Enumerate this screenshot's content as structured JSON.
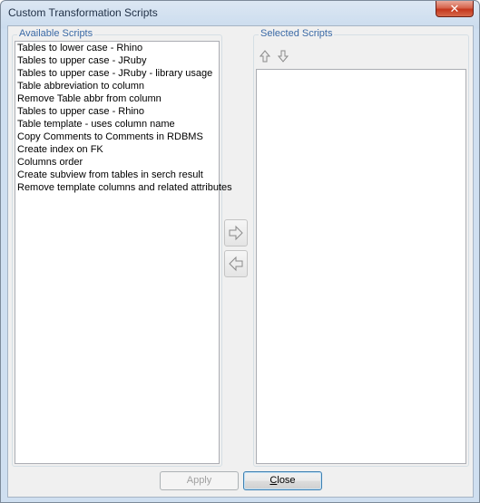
{
  "window": {
    "title": "Custom Transformation Scripts",
    "close_glyph": "✕"
  },
  "available": {
    "label": "Available Scripts",
    "items": [
      "Tables to lower case - Rhino",
      "Tables to upper case - JRuby",
      "Tables to upper case - JRuby - library usage",
      "Table abbreviation to column",
      "Remove Table abbr from column",
      "Tables to upper case - Rhino",
      "Table template - uses column name",
      "Copy Comments to Comments in RDBMS",
      "Create index on FK",
      "Columns order",
      "Create subview from tables in serch result",
      "Remove template columns and related attributes"
    ]
  },
  "selected": {
    "label": "Selected Scripts",
    "items": []
  },
  "buttons": {
    "apply": "Apply",
    "close_first": "C",
    "close_rest": "lose"
  },
  "colors": {
    "group_label": "#3b6aa6",
    "close_button_red": "#c4371d"
  }
}
